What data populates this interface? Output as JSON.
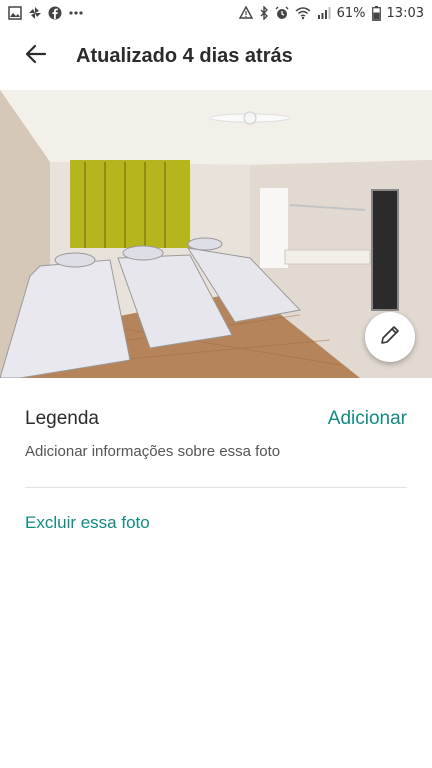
{
  "status_bar": {
    "battery": "61%",
    "time": "13:03",
    "left_icons": [
      "image-icon",
      "pinwheel-icon",
      "facebook-icon",
      "more-dots-icon"
    ],
    "right_icons": [
      "warning-icon",
      "bluetooth-icon",
      "alarm-icon",
      "wifi-icon",
      "signal-icon",
      "battery-icon"
    ]
  },
  "app_bar": {
    "title": "Atualizado 4 dias atrás",
    "back_icon": "arrow-left-icon"
  },
  "photo": {
    "edit_icon": "pencil-icon"
  },
  "caption": {
    "title": "Legenda",
    "add_label": "Adicionar",
    "hint": "Adicionar informações sobre essa foto"
  },
  "actions": {
    "delete_label": "Excluir essa foto"
  },
  "colors": {
    "accent": "#128a84",
    "title": "#2b2b2b"
  }
}
